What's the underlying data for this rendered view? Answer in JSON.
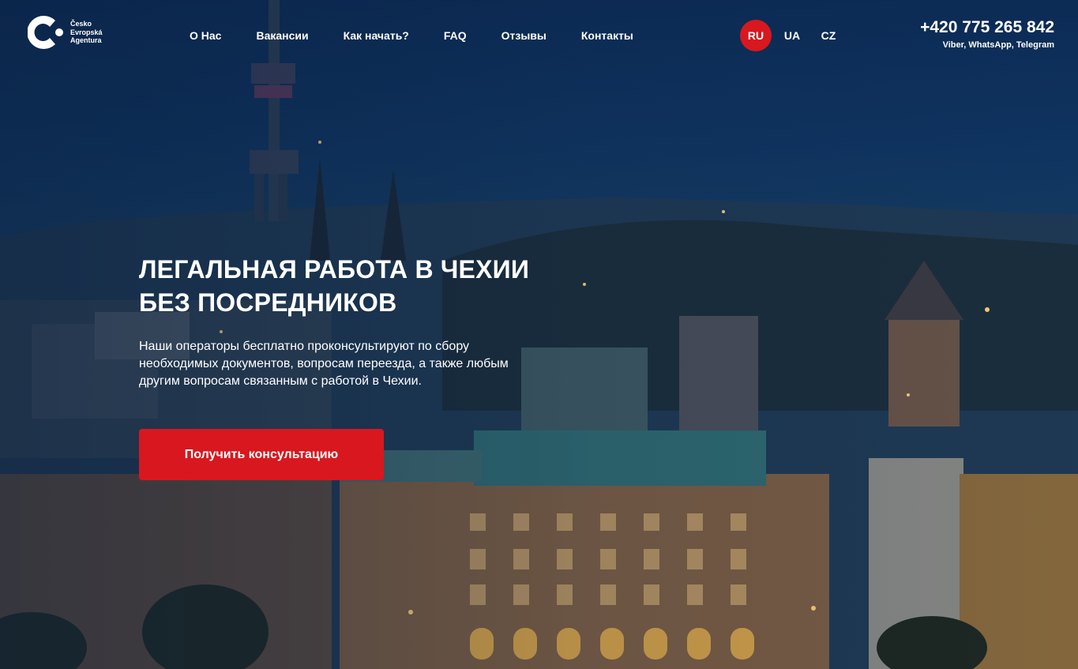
{
  "logo": {
    "lines": [
      "Česko",
      "Evropská",
      "Agentura"
    ],
    "icon": "logo-c-mark"
  },
  "nav": {
    "items": [
      {
        "label": "О Нас"
      },
      {
        "label": "Вакансии"
      },
      {
        "label": "Как начать?"
      },
      {
        "label": "FAQ"
      },
      {
        "label": "Отзывы"
      },
      {
        "label": "Контакты"
      }
    ]
  },
  "languages": {
    "items": [
      {
        "code": "RU",
        "active": true
      },
      {
        "code": "UA",
        "active": false
      },
      {
        "code": "CZ",
        "active": false
      }
    ]
  },
  "contact": {
    "phone": "+420 775 265 842",
    "messengers": "Viber, WhatsApp, Telegram"
  },
  "hero": {
    "title_line1": "ЛЕГАЛЬНАЯ РАБОТА В ЧЕХИИ",
    "title_line2": "БЕЗ ПОСРЕДНИКОВ",
    "description": "Наши операторы бесплатно проконсультируют по сбору необходимых документов, вопросам переезда, а также любым другим вопросам связанным с работой в Чехии.",
    "cta_label": "Получить консультацию",
    "background": "prague-night-cityscape"
  },
  "colors": {
    "accent": "#d8181e",
    "text": "#ffffff",
    "sky": "#0f3561"
  }
}
